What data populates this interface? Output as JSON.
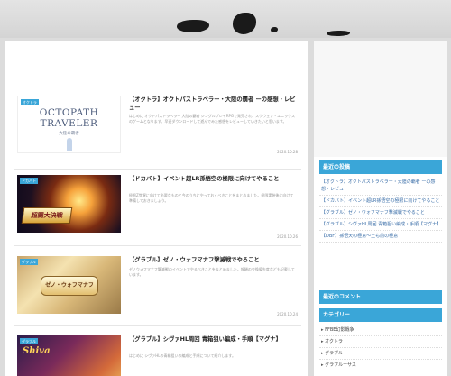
{
  "colors": {
    "accent": "#3aa6d8",
    "page_bg": "#dcdcdc",
    "card_bg": "#ffffff"
  },
  "posts": [
    {
      "badge": "オクトラ",
      "thumb_title": "OCTOPATH\nTRAVELER",
      "thumb_subtitle": "大陸の覇者",
      "title": "【オクトラ】オクトパストラベラー・大陸の覇者 ーの感想・レビュー",
      "excerpt": "はじめに オクトパストラベラー 大陸の覇者 シングルプレイRPGで発売され、スクウェア・エニックスのゲームとなります。早速ダウンロードして遊んでみた感想をレビューしていきたいと思います。",
      "date": "2020.10.28"
    },
    {
      "badge": "ドカバト",
      "thumb_title": "超闘大決戦",
      "title": "【ドカバト】イベント超LR孫悟空の極限に向けてやること",
      "excerpt": "極限Z覚醒に向けて必要なものと今のうちにやっておくべきことをまとめました。極限実装後に向けて準備しておきましょう。",
      "date": "2020.10.26"
    },
    {
      "badge": "グラブル",
      "thumb_title": "ゼノ・ウォフマナフ",
      "title": "【グラブル】ゼノ・ウォフマナフ撃滅戦でやること",
      "excerpt": "ゼノウォフマナフ撃滅戦のイベントでやるべきことをまとめました。報酬の交換優先度なども記載しています。",
      "date": "2020.10.24"
    },
    {
      "badge": "グラブル",
      "thumb_title": "Shiva",
      "title": "【グラブル】シヴァHL周回 青箱狙い編成・手順【マグナ】",
      "excerpt": "はじめに シヴァHLの青箱狙いの編成と手順について紹介します。",
      "date": "2020.10.22"
    }
  ],
  "sidebar": {
    "recent_posts_title": "最近の投稿",
    "recent_posts": [
      "【オクトラ】オクトパストラベラー・大陸の覇者 ーの感想・レビュー",
      "【ドカバト】イベント超LR孫悟空の極限に向けてやること",
      "【グラブル】ゼノ・ウォフマナフ撃滅戦でやること",
      "【グラブル】シヴァHL周回 青箱狙い編成・手順【マグナ】",
      "【DBF】孫悟天の極意〜王も前の極意"
    ],
    "recent_comments_title": "最近のコメント",
    "categories_title": "カテゴリー",
    "categories": [
      "FFBE幻影戦争",
      "オクトラ",
      "グラブル",
      "グラブルーサス"
    ]
  }
}
